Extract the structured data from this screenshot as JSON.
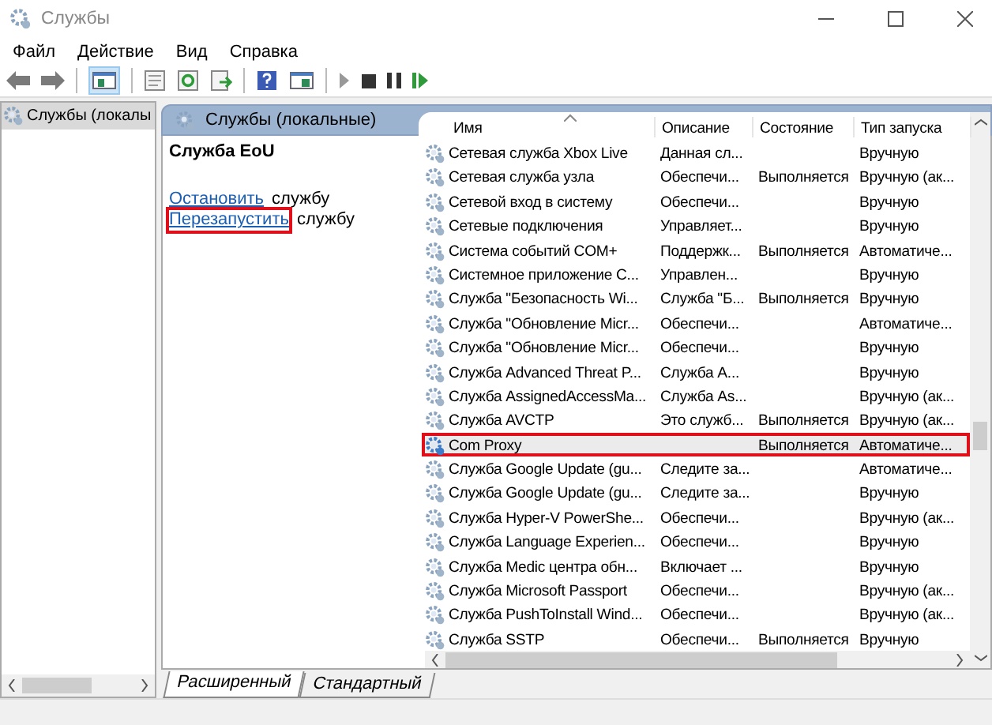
{
  "window": {
    "title": "Службы"
  },
  "menu": [
    "Файл",
    "Действие",
    "Вид",
    "Справка"
  ],
  "tree": {
    "items": [
      {
        "label": "Службы (локалы",
        "selected": true
      }
    ]
  },
  "panel": {
    "title": "Службы (локальные)",
    "service_name": "Служба EoU",
    "actions": [
      {
        "link": "Остановить",
        "rest": "службу",
        "annotated": false
      },
      {
        "link": "Перезапустить",
        "rest": "службу",
        "annotated": true
      }
    ]
  },
  "table": {
    "columns": [
      "Имя",
      "Описание",
      "Состояние",
      "Тип запуска"
    ],
    "rows": [
      {
        "name": "Сетевая служба Xbox Live",
        "description": "Данная сл...",
        "state": "",
        "startup": "Вручную",
        "selected": false,
        "annotated": false
      },
      {
        "name": "Сетевая служба узла",
        "description": "Обеспечи...",
        "state": "Выполняется",
        "startup": "Вручную (ак...",
        "selected": false,
        "annotated": false
      },
      {
        "name": "Сетевой вход в систему",
        "description": "Обеспечи...",
        "state": "",
        "startup": "Вручную",
        "selected": false,
        "annotated": false
      },
      {
        "name": "Сетевые подключения",
        "description": "Управляет...",
        "state": "",
        "startup": "Вручную",
        "selected": false,
        "annotated": false
      },
      {
        "name": "Система событий COM+",
        "description": "Поддержк...",
        "state": "Выполняется",
        "startup": "Автоматиче...",
        "selected": false,
        "annotated": false
      },
      {
        "name": "Системное приложение C...",
        "description": "Управлен...",
        "state": "",
        "startup": "Вручную",
        "selected": false,
        "annotated": false
      },
      {
        "name": "Служба \"Безопасность Wi...",
        "description": "Служба \"Б...",
        "state": "Выполняется",
        "startup": "Вручную",
        "selected": false,
        "annotated": false
      },
      {
        "name": "Служба \"Обновление Micr...",
        "description": "Обеспечи...",
        "state": "",
        "startup": "Автоматиче...",
        "selected": false,
        "annotated": false
      },
      {
        "name": "Служба \"Обновление Micr...",
        "description": "Обеспечи...",
        "state": "",
        "startup": "Вручную",
        "selected": false,
        "annotated": false
      },
      {
        "name": "Служба Advanced Threat P...",
        "description": "Служба A...",
        "state": "",
        "startup": "Вручную",
        "selected": false,
        "annotated": false
      },
      {
        "name": "Служба AssignedAccessMa...",
        "description": "Служба As...",
        "state": "",
        "startup": "Вручную (ак...",
        "selected": false,
        "annotated": false
      },
      {
        "name": "Служба AVCTP",
        "description": "Это служб...",
        "state": "Выполняется",
        "startup": "Вручную (ак...",
        "selected": false,
        "annotated": false
      },
      {
        "name": "Com Proxy",
        "description": "",
        "state": "Выполняется",
        "startup": "Автоматиче...",
        "selected": true,
        "annotated": true
      },
      {
        "name": "Служба Google Update (gu...",
        "description": "Следите за...",
        "state": "",
        "startup": "Автоматиче...",
        "selected": false,
        "annotated": false
      },
      {
        "name": "Служба Google Update (gu...",
        "description": "Следите за...",
        "state": "",
        "startup": "Вручную",
        "selected": false,
        "annotated": false
      },
      {
        "name": "Служба Hyper-V PowerShe...",
        "description": "Обеспечи...",
        "state": "",
        "startup": "Вручную (ак...",
        "selected": false,
        "annotated": false
      },
      {
        "name": "Служба Language Experien...",
        "description": "Обеспечи...",
        "state": "",
        "startup": "Вручную",
        "selected": false,
        "annotated": false
      },
      {
        "name": "Служба Medic центра обн...",
        "description": "Включает ...",
        "state": "",
        "startup": "Вручную",
        "selected": false,
        "annotated": false
      },
      {
        "name": "Служба Microsoft Passport",
        "description": "Обеспечи...",
        "state": "",
        "startup": "Вручную (ак...",
        "selected": false,
        "annotated": false
      },
      {
        "name": "Служба PushToInstall Wind...",
        "description": "Обеспечи...",
        "state": "",
        "startup": "Вручную (ак...",
        "selected": false,
        "annotated": false
      },
      {
        "name": "Служба SSTP",
        "description": "Обеспечи...",
        "state": "Выполняется",
        "startup": "Вручную",
        "selected": false,
        "annotated": false
      }
    ]
  },
  "tabs": [
    {
      "label": "Расширенный",
      "selected": true
    },
    {
      "label": "Стандартный",
      "selected": false
    }
  ]
}
